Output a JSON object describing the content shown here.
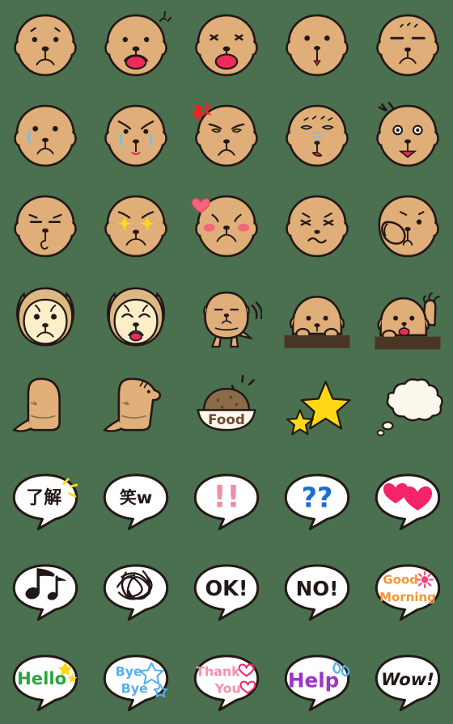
{
  "sheet": {
    "title": "Dog Emoji Sticker Sheet",
    "background_color": "#4a7050",
    "columns": 5,
    "rows": 8,
    "cell_size": 112,
    "palette": {
      "dog_body": "#dfae79",
      "dog_body_light": "#e8c396",
      "dog_face_cream": "#fbeec9",
      "dog_ear_tan": "#ddb884",
      "outline": "#231815",
      "tongue_pink": "#ee2a5c",
      "blush_pink": "#f4647e",
      "tear_blue": "#6ec4e8",
      "star_yellow": "#ffd815",
      "bubble_white": "#ffffff",
      "wall_brown": "#4b3523",
      "kibble_brown": "#8b6b48",
      "heart_pink": "#f5246a",
      "question_blue": "#1a6fd4",
      "exclaim_pink": "#f58da1",
      "hello_green": "#2aa63a",
      "bye_blue": "#57b0e8",
      "thankyou_pink": "#f890ab",
      "help_purple": "#9a36c4",
      "goodmorning_orange": "#f39636",
      "sun_pink": "#f4447f",
      "anger_red": "#ee2222"
    }
  },
  "emojis": [
    {
      "id": 1,
      "row": 1,
      "col": 1,
      "name": "dog-face-neutral",
      "label": "neutral face",
      "text": ""
    },
    {
      "id": 2,
      "row": 1,
      "col": 2,
      "name": "dog-face-happy-tongue",
      "label": "happy with tongue",
      "text": ""
    },
    {
      "id": 3,
      "row": 1,
      "col": 3,
      "name": "dog-face-joy-tongue",
      "label": "squint joy tongue",
      "text": ""
    },
    {
      "id": 4,
      "row": 1,
      "col": 4,
      "name": "dog-face-sad-drip",
      "label": "sad drooping mouth",
      "text": ""
    },
    {
      "id": 5,
      "row": 1,
      "col": 5,
      "name": "dog-face-sleepy",
      "label": "sleepy closed eyes",
      "text": ""
    },
    {
      "id": 6,
      "row": 2,
      "col": 1,
      "name": "dog-face-single-tear",
      "label": "single tear",
      "text": ""
    },
    {
      "id": 7,
      "row": 2,
      "col": 2,
      "name": "dog-face-crying",
      "label": "crying sad brows",
      "text": ""
    },
    {
      "id": 8,
      "row": 2,
      "col": 3,
      "name": "dog-face-angry",
      "label": "angry with anger mark",
      "text": ""
    },
    {
      "id": 9,
      "row": 2,
      "col": 4,
      "name": "dog-face-sick",
      "label": "sick queasy face",
      "text": ""
    },
    {
      "id": 10,
      "row": 2,
      "col": 5,
      "name": "dog-face-shocked",
      "label": "shocked wide eyes",
      "text": ""
    },
    {
      "id": 11,
      "row": 3,
      "col": 1,
      "name": "dog-face-whistle",
      "label": "whistling",
      "text": ""
    },
    {
      "id": 12,
      "row": 3,
      "col": 2,
      "name": "dog-face-sparkle-eyes",
      "label": "sparkling eyes",
      "text": ""
    },
    {
      "id": 13,
      "row": 3,
      "col": 3,
      "name": "dog-face-love-blush",
      "label": "blushing with heart",
      "text": ""
    },
    {
      "id": 14,
      "row": 3,
      "col": 4,
      "name": "dog-face-grumpy",
      "label": "grumpy wavy mouth",
      "text": ""
    },
    {
      "id": 15,
      "row": 3,
      "col": 5,
      "name": "dog-face-thinking-paw",
      "label": "thinking with paw",
      "text": ""
    },
    {
      "id": 16,
      "row": 4,
      "col": 1,
      "name": "cream-dog-face-neutral",
      "label": "cream dog neutral",
      "text": ""
    },
    {
      "id": 17,
      "row": 4,
      "col": 2,
      "name": "cream-dog-face-tongue",
      "label": "cream dog tongue out",
      "text": ""
    },
    {
      "id": 18,
      "row": 4,
      "col": 3,
      "name": "dog-body-tail-wag",
      "label": "dog wagging tail",
      "text": ""
    },
    {
      "id": 19,
      "row": 4,
      "col": 4,
      "name": "dog-peeking-over-wall",
      "label": "peeking over wall",
      "text": ""
    },
    {
      "id": 20,
      "row": 4,
      "col": 5,
      "name": "dog-waving-over-wall",
      "label": "waving over wall",
      "text": ""
    },
    {
      "id": 21,
      "row": 5,
      "col": 1,
      "name": "dog-standing-back",
      "label": "standing facing away",
      "text": ""
    },
    {
      "id": 22,
      "row": 5,
      "col": 2,
      "name": "dog-standing-side",
      "label": "standing side view",
      "text": ""
    },
    {
      "id": 23,
      "row": 5,
      "col": 3,
      "name": "food-bowl",
      "label": "food bowl",
      "text": "Food"
    },
    {
      "id": 24,
      "row": 5,
      "col": 4,
      "name": "sparkle-stars",
      "label": "yellow stars",
      "text": ""
    },
    {
      "id": 25,
      "row": 5,
      "col": 5,
      "name": "thought-cloud-empty",
      "label": "empty thought cloud",
      "text": ""
    },
    {
      "id": 26,
      "row": 6,
      "col": 1,
      "name": "bubble-ryoukai",
      "label": "understood bubble",
      "text": "了解"
    },
    {
      "id": 27,
      "row": 6,
      "col": 2,
      "name": "bubble-warai",
      "label": "laugh bubble",
      "text": "笑w"
    },
    {
      "id": 28,
      "row": 6,
      "col": 3,
      "name": "bubble-exclamation",
      "label": "double exclamation",
      "text": "!!"
    },
    {
      "id": 29,
      "row": 6,
      "col": 4,
      "name": "bubble-question",
      "label": "double question",
      "text": "??"
    },
    {
      "id": 30,
      "row": 6,
      "col": 5,
      "name": "bubble-hearts",
      "label": "hearts bubble",
      "text": ""
    },
    {
      "id": 31,
      "row": 7,
      "col": 1,
      "name": "bubble-music-notes",
      "label": "music notes bubble",
      "text": ""
    },
    {
      "id": 32,
      "row": 7,
      "col": 2,
      "name": "bubble-scribble",
      "label": "scribble bubble",
      "text": ""
    },
    {
      "id": 33,
      "row": 7,
      "col": 3,
      "name": "bubble-ok",
      "label": "OK bubble",
      "text": "OK!"
    },
    {
      "id": 34,
      "row": 7,
      "col": 4,
      "name": "bubble-no",
      "label": "NO bubble",
      "text": "NO!"
    },
    {
      "id": 35,
      "row": 7,
      "col": 5,
      "name": "bubble-good-morning",
      "label": "good morning bubble",
      "text": "Good Morning"
    },
    {
      "id": 36,
      "row": 8,
      "col": 1,
      "name": "bubble-hello",
      "label": "hello bubble",
      "text": "Hello"
    },
    {
      "id": 37,
      "row": 8,
      "col": 2,
      "name": "bubble-bye-bye",
      "label": "bye bye bubble",
      "text": "Bye Bye"
    },
    {
      "id": 38,
      "row": 8,
      "col": 3,
      "name": "bubble-thank-you",
      "label": "thank you bubble",
      "text": "Thank You"
    },
    {
      "id": 39,
      "row": 8,
      "col": 4,
      "name": "bubble-help",
      "label": "help bubble",
      "text": "Help"
    },
    {
      "id": 40,
      "row": 8,
      "col": 5,
      "name": "bubble-wow",
      "label": "wow bubble",
      "text": "Wow!"
    }
  ],
  "labels": {
    "food_bowl": "Food",
    "ryoukai": "了解",
    "warai": "笑w",
    "exclamation": "!!",
    "question": "??",
    "ok": "OK!",
    "no": "NO!",
    "good": "Good",
    "morning": "Morning",
    "hello": "Hello",
    "bye1": "Bye",
    "bye2": "Bye",
    "thank": "Thank",
    "you": "You",
    "help": "Help",
    "wow": "Wow!"
  }
}
